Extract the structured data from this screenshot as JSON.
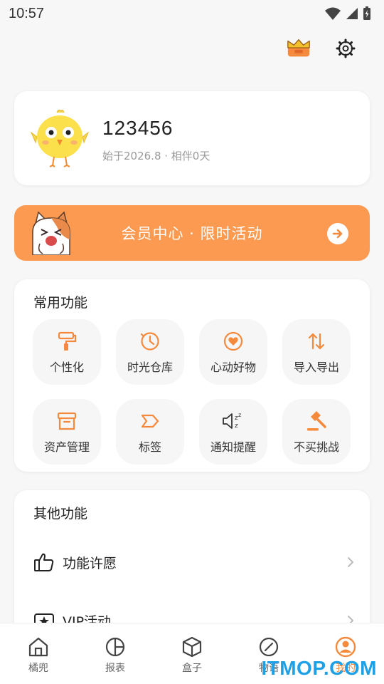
{
  "status_bar": {
    "time": "10:57"
  },
  "profile": {
    "username": "123456",
    "since": "始于2026.8 · 相伴0天"
  },
  "vip_banner": {
    "label": "会员中心 · 限时活动"
  },
  "common": {
    "title": "常用功能",
    "items": [
      {
        "label": "个性化",
        "icon": "paint-roller-icon"
      },
      {
        "label": "时光仓库",
        "icon": "clock-icon"
      },
      {
        "label": "心动好物",
        "icon": "heart-icon"
      },
      {
        "label": "导入导出",
        "icon": "transfer-arrows-icon"
      },
      {
        "label": "资产管理",
        "icon": "archive-box-icon"
      },
      {
        "label": "标签",
        "icon": "tag-icon"
      },
      {
        "label": "通知提醒",
        "icon": "speaker-icon"
      },
      {
        "label": "不买挑战",
        "icon": "gavel-icon"
      }
    ]
  },
  "other": {
    "title": "其他功能",
    "items": [
      {
        "label": "功能许愿",
        "icon": "thumbs-up-icon"
      },
      {
        "label": "VIP活动",
        "icon": "vip-star-icon"
      }
    ]
  },
  "tabs": [
    {
      "label": "橘兜",
      "icon": "home-icon"
    },
    {
      "label": "报表",
      "icon": "pie-chart-icon"
    },
    {
      "label": "盒子",
      "icon": "box-icon"
    },
    {
      "label": "物语",
      "icon": "compass-icon"
    },
    {
      "label": "我的",
      "icon": "user-circle-icon",
      "active": true
    }
  ],
  "watermark": "ITMOP.COM",
  "colors": {
    "accent": "#fb9a50",
    "icon_orange": "#f5893c",
    "background": "#f7f7f7"
  }
}
